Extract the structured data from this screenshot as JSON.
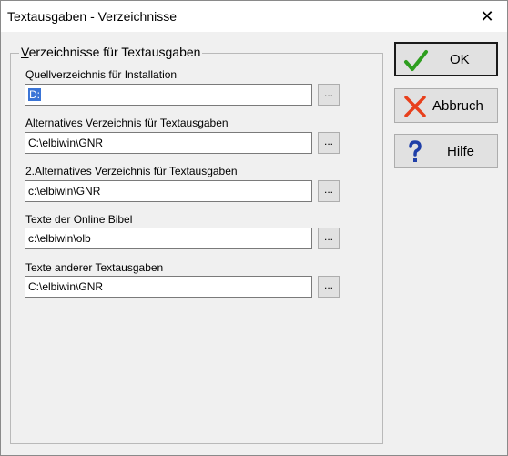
{
  "window": {
    "title": "Textausgaben - Verzeichnisse",
    "close_glyph": "✕"
  },
  "group": {
    "title_prefix": "V",
    "title_rest": "erzeichnisse für Textausgaben"
  },
  "fields": [
    {
      "label": "Quellverzeichnis für Installation",
      "value": "D:",
      "browse": "..."
    },
    {
      "label": "Alternatives Verzeichnis für Textausgaben",
      "value": "C:\\elbiwin\\GNR",
      "browse": "..."
    },
    {
      "label": "2.Alternatives Verzeichnis für Textausgaben",
      "value": "c:\\elbiwin\\GNR",
      "browse": "..."
    },
    {
      "label": "Texte der Online Bibel",
      "value": "c:\\elbiwin\\olb",
      "browse": "..."
    },
    {
      "label": "Texte anderer Textausgaben",
      "value": "C:\\elbiwin\\GNR",
      "browse": "..."
    }
  ],
  "buttons": {
    "ok": {
      "label": "OK",
      "icon": "checkmark-icon",
      "color": "#2e9e1f"
    },
    "cancel": {
      "label": "Abbruch",
      "icon": "x-cross-icon",
      "color": "#e8401c"
    },
    "help": {
      "label_underlined": "H",
      "label_rest": "ilfe",
      "icon": "question-mark-icon",
      "color": "#1f3fa8"
    }
  }
}
